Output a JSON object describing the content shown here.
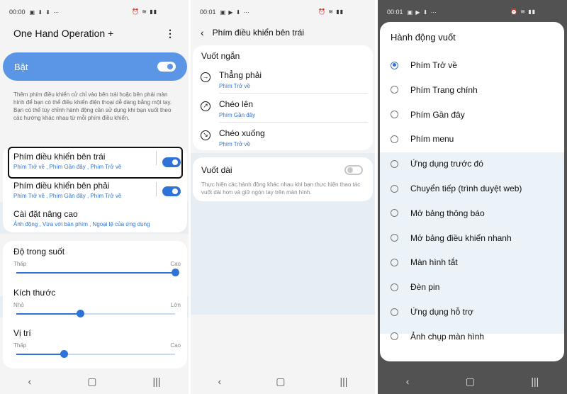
{
  "screen1": {
    "time": "00:00",
    "status_icons": "▣ ⬇ ⬇ ⋯",
    "right_icons": "⏰ ≋ ▮▮",
    "title": "One Hand Operation +",
    "toggle_label": "Bật",
    "description": "Thêm phím điều khiển cử chỉ vào bên trái hoặc bên phải màn hình để bạn có thể điều khiển điện thoại dễ dàng bằng một tay.\nBạn có thể tùy chỉnh hành động cần sử dụng khi bạn vuốt theo các hướng khác nhau từ mỗi phím điều khiển.",
    "left_handle": {
      "title": "Phím điều khiển bên trái",
      "sub": "Phím Trở về , Phím Gần đây , Phím Trở về"
    },
    "right_handle": {
      "title": "Phím điều khiển bên phải",
      "sub": "Phím Trở về , Phím Gần đây , Phím Trở về"
    },
    "advanced": {
      "title": "Cài đặt nâng cao",
      "sub": "Ảnh động , Vừa với bàn phím , Ngoại lệ của ứng dụng"
    },
    "transparency": {
      "label": "Độ trong suốt",
      "min": "Thấp",
      "max": "Cao",
      "value": 1.0
    },
    "size": {
      "label": "Kích thước",
      "min": "Nhỏ",
      "max": "Lớn",
      "value": 0.4
    },
    "position": {
      "label": "Vị trí",
      "min": "Thấp",
      "max": "Cao",
      "value": 0.3
    }
  },
  "screen2": {
    "time": "00:01",
    "status_icons": "▣ ▶ ⬇ ⋯",
    "right_icons": "⏰ ≋ ▮▮",
    "title": "Phím điều khiển bên trái",
    "short_swipe_label": "Vuốt ngắn",
    "directions": [
      {
        "title": "Thẳng phải",
        "sub": "Phím Trở về",
        "icon": "→"
      },
      {
        "title": "Chéo lên",
        "sub": "Phím Gần đây",
        "icon": "↗"
      },
      {
        "title": "Chéo xuống",
        "sub": "Phím Trở về",
        "icon": "↘"
      }
    ],
    "long_swipe_label": "Vuốt dài",
    "long_swipe_desc": "Thực hiện các hành động khác nhau khi bạn thực hiện thao tác vuốt dài hơn và giữ ngón tay trên màn hình."
  },
  "screen3": {
    "time": "00:01",
    "status_icons": "▣ ▶ ⬇ ⋯",
    "right_icons": "⏰ ≋ ▮▮",
    "title": "Hành động vuốt",
    "options": [
      "Phím Trở về",
      "Phím Trang chính",
      "Phím Gần đây",
      "Phím menu",
      "Ứng dụng trước đó",
      "Chuyển tiếp (trình duyệt web)",
      "Mở bảng thông báo",
      "Mở bảng điều khiển nhanh",
      "Màn hình tắt",
      "Đèn pin",
      "Ứng dụng hỗ trợ",
      "Ảnh chụp màn hình"
    ],
    "selected_index": 0
  },
  "nav": {
    "back": "‹",
    "home": "▢",
    "recents": "|||"
  },
  "colors": {
    "accent": "#2f73d8",
    "toggle_bar": "#5a95e6"
  }
}
